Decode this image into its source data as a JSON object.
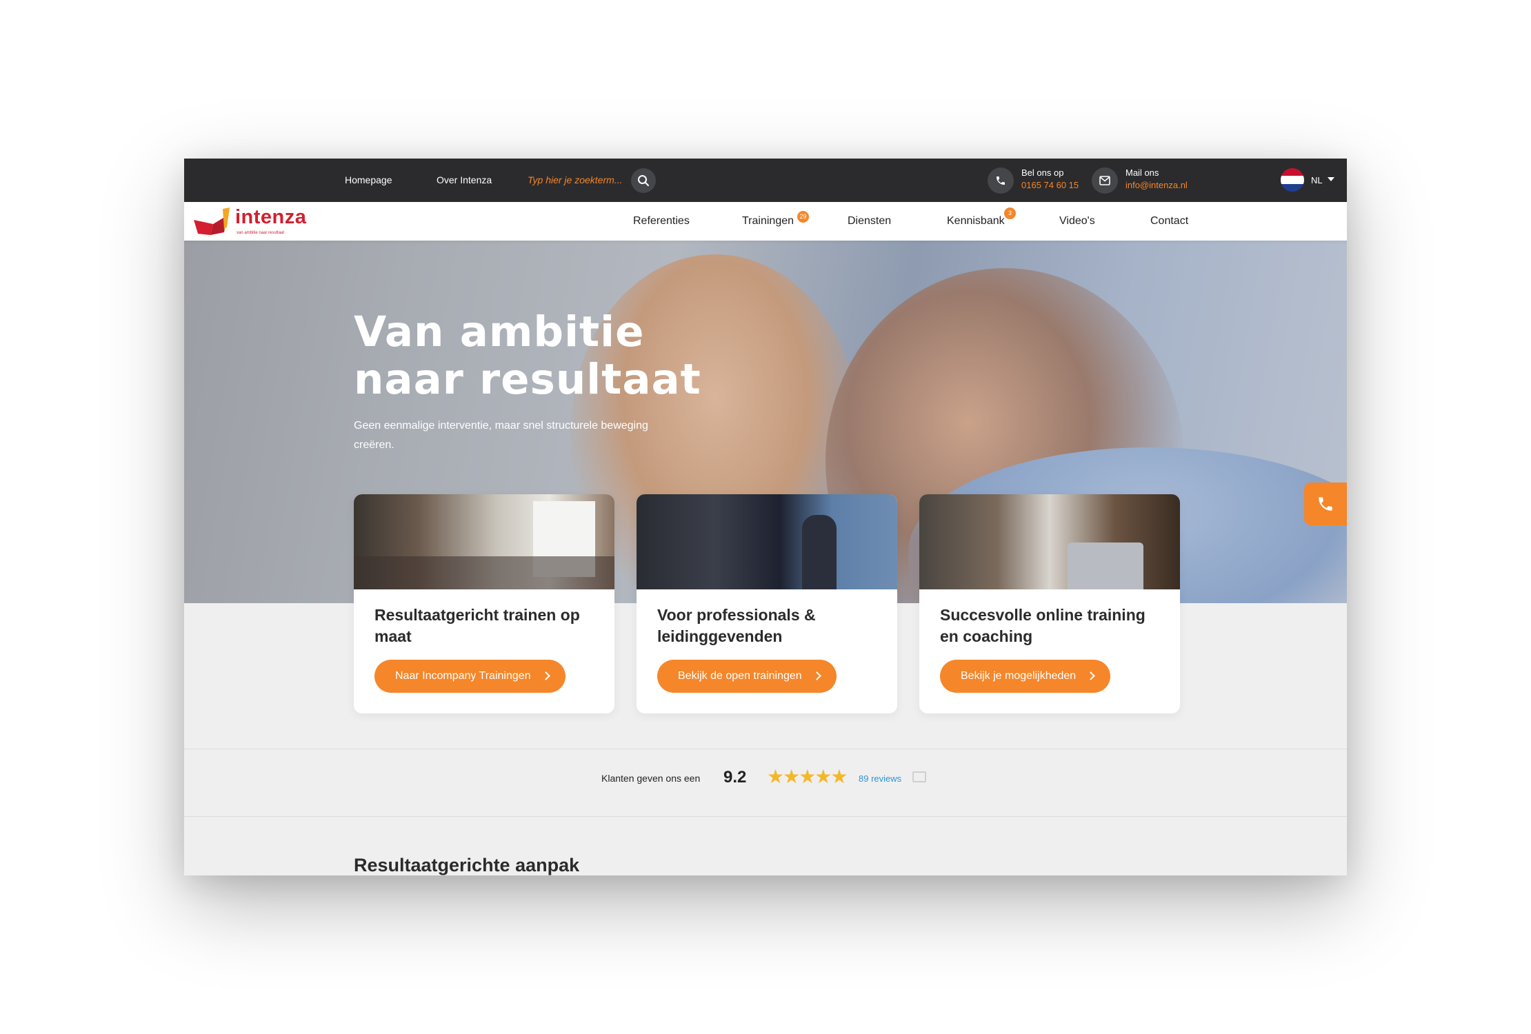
{
  "topbar": {
    "nav": [
      "Homepage",
      "Over Intenza"
    ],
    "search_placeholder": "Typ hier je zoekterm...",
    "phone": {
      "label": "Bel ons op",
      "value": "0165 74 60 15"
    },
    "mail": {
      "label": "Mail ons",
      "value": "info@intenza.nl"
    },
    "language": "NL"
  },
  "logo": {
    "name": "intenza",
    "tagline": "van ambitie naar resultaat"
  },
  "mainnav": {
    "items": [
      "Referenties",
      "Trainingen",
      "Diensten",
      "Kennisbank",
      "Video's",
      "Contact"
    ],
    "trainingen_badge": "29",
    "kennisbank_badge": "3"
  },
  "hero": {
    "title_line1": "Van ambitie",
    "title_line2": "naar resultaat",
    "subtitle": "Geen eenmalige interventie, maar snel structurele beweging creëren."
  },
  "cards": [
    {
      "title": "Resultaatgericht trainen op maat",
      "button": "Naar Incompany Trainingen"
    },
    {
      "title": "Voor professionals & leidinggevenden",
      "button": "Bekijk de open trainingen"
    },
    {
      "title": "Succesvolle online training en coaching",
      "button": "Bekijk je mogelijkheden"
    }
  ],
  "reviews": {
    "text": "Klanten geven ons een",
    "score": "9.2",
    "stars": "★★★★★",
    "rating_out_of_5": 4.6,
    "link": "89 reviews"
  },
  "section": {
    "title": "Resultaatgerichte aanpak"
  },
  "colors": {
    "accent": "#f5862a",
    "dark": "#2b2b2d",
    "brand_red": "#d31f2f",
    "link": "#2f95d3"
  },
  "icons": [
    "search-icon",
    "phone-icon",
    "mail-icon",
    "flag-nl-icon",
    "chevron-down-icon",
    "chevron-right-icon",
    "external-link-icon"
  ]
}
